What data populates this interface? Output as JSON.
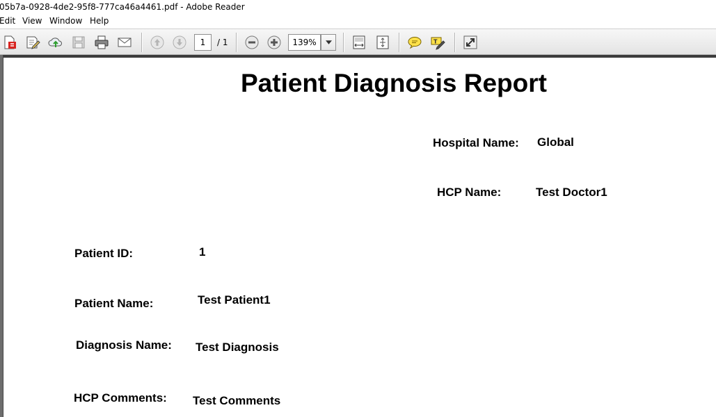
{
  "window": {
    "title": "05b7a-0928-4de2-95f8-777ca46a4461.pdf - Adobe Reader"
  },
  "menu": {
    "items": [
      "Edit",
      "View",
      "Window",
      "Help"
    ]
  },
  "toolbar": {
    "page_current": "1",
    "page_total": "/ 1",
    "zoom": "139%"
  },
  "report": {
    "title": "Patient Diagnosis Report",
    "hospital_label": "Hospital Name:",
    "hospital_value": "Global",
    "hcp_label": "HCP Name:",
    "hcp_value": "Test Doctor1",
    "patient_id_label": "Patient ID:",
    "patient_id_value": "1",
    "patient_name_label": "Patient Name:",
    "patient_name_value": "Test Patient1",
    "diagnosis_label": "Diagnosis Name:",
    "diagnosis_value": "Test Diagnosis",
    "comments_label": "HCP Comments:",
    "comments_value": "Test Comments"
  }
}
